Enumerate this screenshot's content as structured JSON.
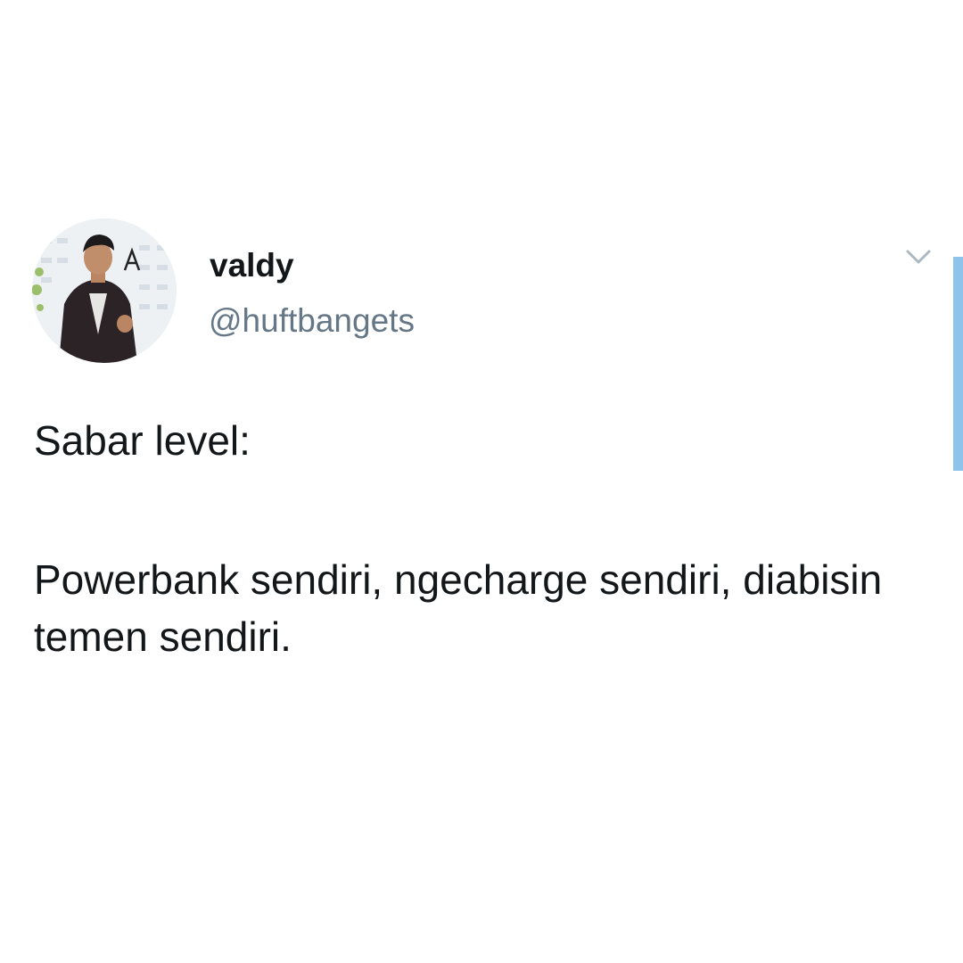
{
  "user": {
    "display_name": "valdy",
    "handle": "@huftbangets",
    "avatar_icon": "user-photo-avatar"
  },
  "tweet": {
    "line1": "Sabar level:",
    "line2": "Powerbank sendiri, ngecharge sendiri, diabisin temen sendiri."
  },
  "menu": {
    "icon": "chevron-down-icon"
  },
  "colors": {
    "name_text": "#14171a",
    "handle_text": "#657786",
    "caret": "#aab8c2",
    "scroll_indicator": "#8ec4ec"
  }
}
